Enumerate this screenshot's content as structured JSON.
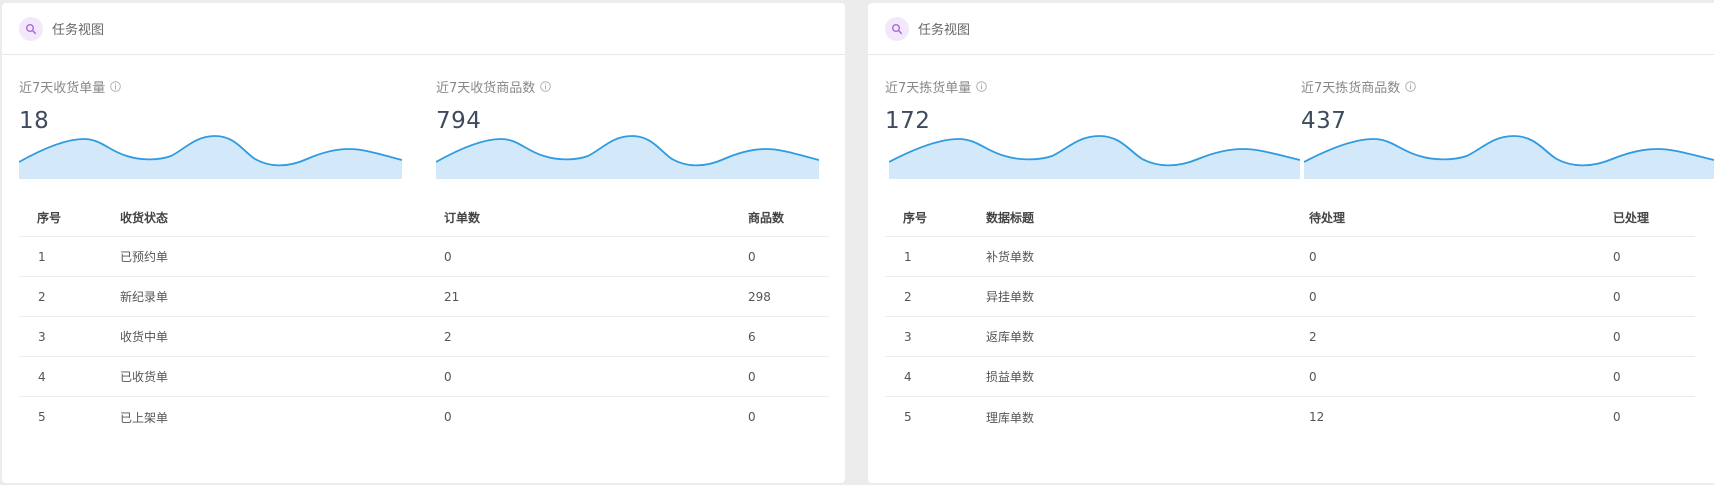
{
  "colors": {
    "line": "#2f9be0",
    "fill": "#d3e9fa",
    "icon_bg": "#f3e8fb",
    "icon": "#a86cd8"
  },
  "panels": [
    {
      "header": {
        "title": "任务视图",
        "icon": "search-icon"
      },
      "metrics": [
        {
          "label": "近7天收货单量",
          "value": "18"
        },
        {
          "label": "近7天收货商品数",
          "value": "794"
        }
      ],
      "table": {
        "headers": [
          "序号",
          "收货状态",
          "订单数",
          "商品数"
        ],
        "rows": [
          [
            "1",
            "已预约单",
            "0",
            "0"
          ],
          [
            "2",
            "新纪录单",
            "21",
            "298"
          ],
          [
            "3",
            "收货中单",
            "2",
            "6"
          ],
          [
            "4",
            "已收货单",
            "0",
            "0"
          ],
          [
            "5",
            "已上架单",
            "0",
            "0"
          ]
        ]
      }
    },
    {
      "header": {
        "title": "任务视图",
        "icon": "search-icon"
      },
      "metrics": [
        {
          "label": "近7天拣货单量",
          "value": "172"
        },
        {
          "label": "近7天拣货商品数",
          "value": "437"
        }
      ],
      "table": {
        "headers": [
          "序号",
          "数据标题",
          "待处理",
          "已处理"
        ],
        "rows": [
          [
            "1",
            "补货单数",
            "0",
            "0"
          ],
          [
            "2",
            "异挂单数",
            "0",
            "0"
          ],
          [
            "3",
            "返库单数",
            "2",
            "0"
          ],
          [
            "4",
            "损益单数",
            "0",
            "0"
          ],
          [
            "5",
            "理库单数",
            "12",
            "0"
          ]
        ]
      }
    }
  ]
}
